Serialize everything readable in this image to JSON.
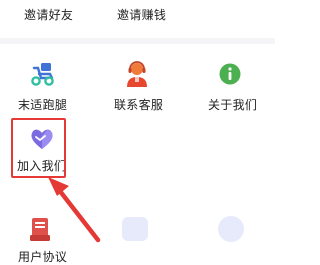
{
  "menu": {
    "invite_friends": "邀请好友",
    "invite_earn": "邀请赚钱",
    "errand": "末适跑腿",
    "customer_service": "联系客服",
    "about_us": "关于我们",
    "join_us": "加入我们",
    "user_agreement": "用户协议"
  },
  "icons": {
    "errand": "scooter-icon",
    "customer_service": "headset-agent-icon",
    "about_us": "info-icon",
    "join_us": "handshake-heart-icon",
    "user_agreement": "document-stamp-icon"
  },
  "colors": {
    "accent": "#e53935",
    "scooter": "#3f73d6",
    "agent": "#f07a3a",
    "info": "#4caf50",
    "join": "#7b6be0",
    "doc": "#e0504a"
  }
}
